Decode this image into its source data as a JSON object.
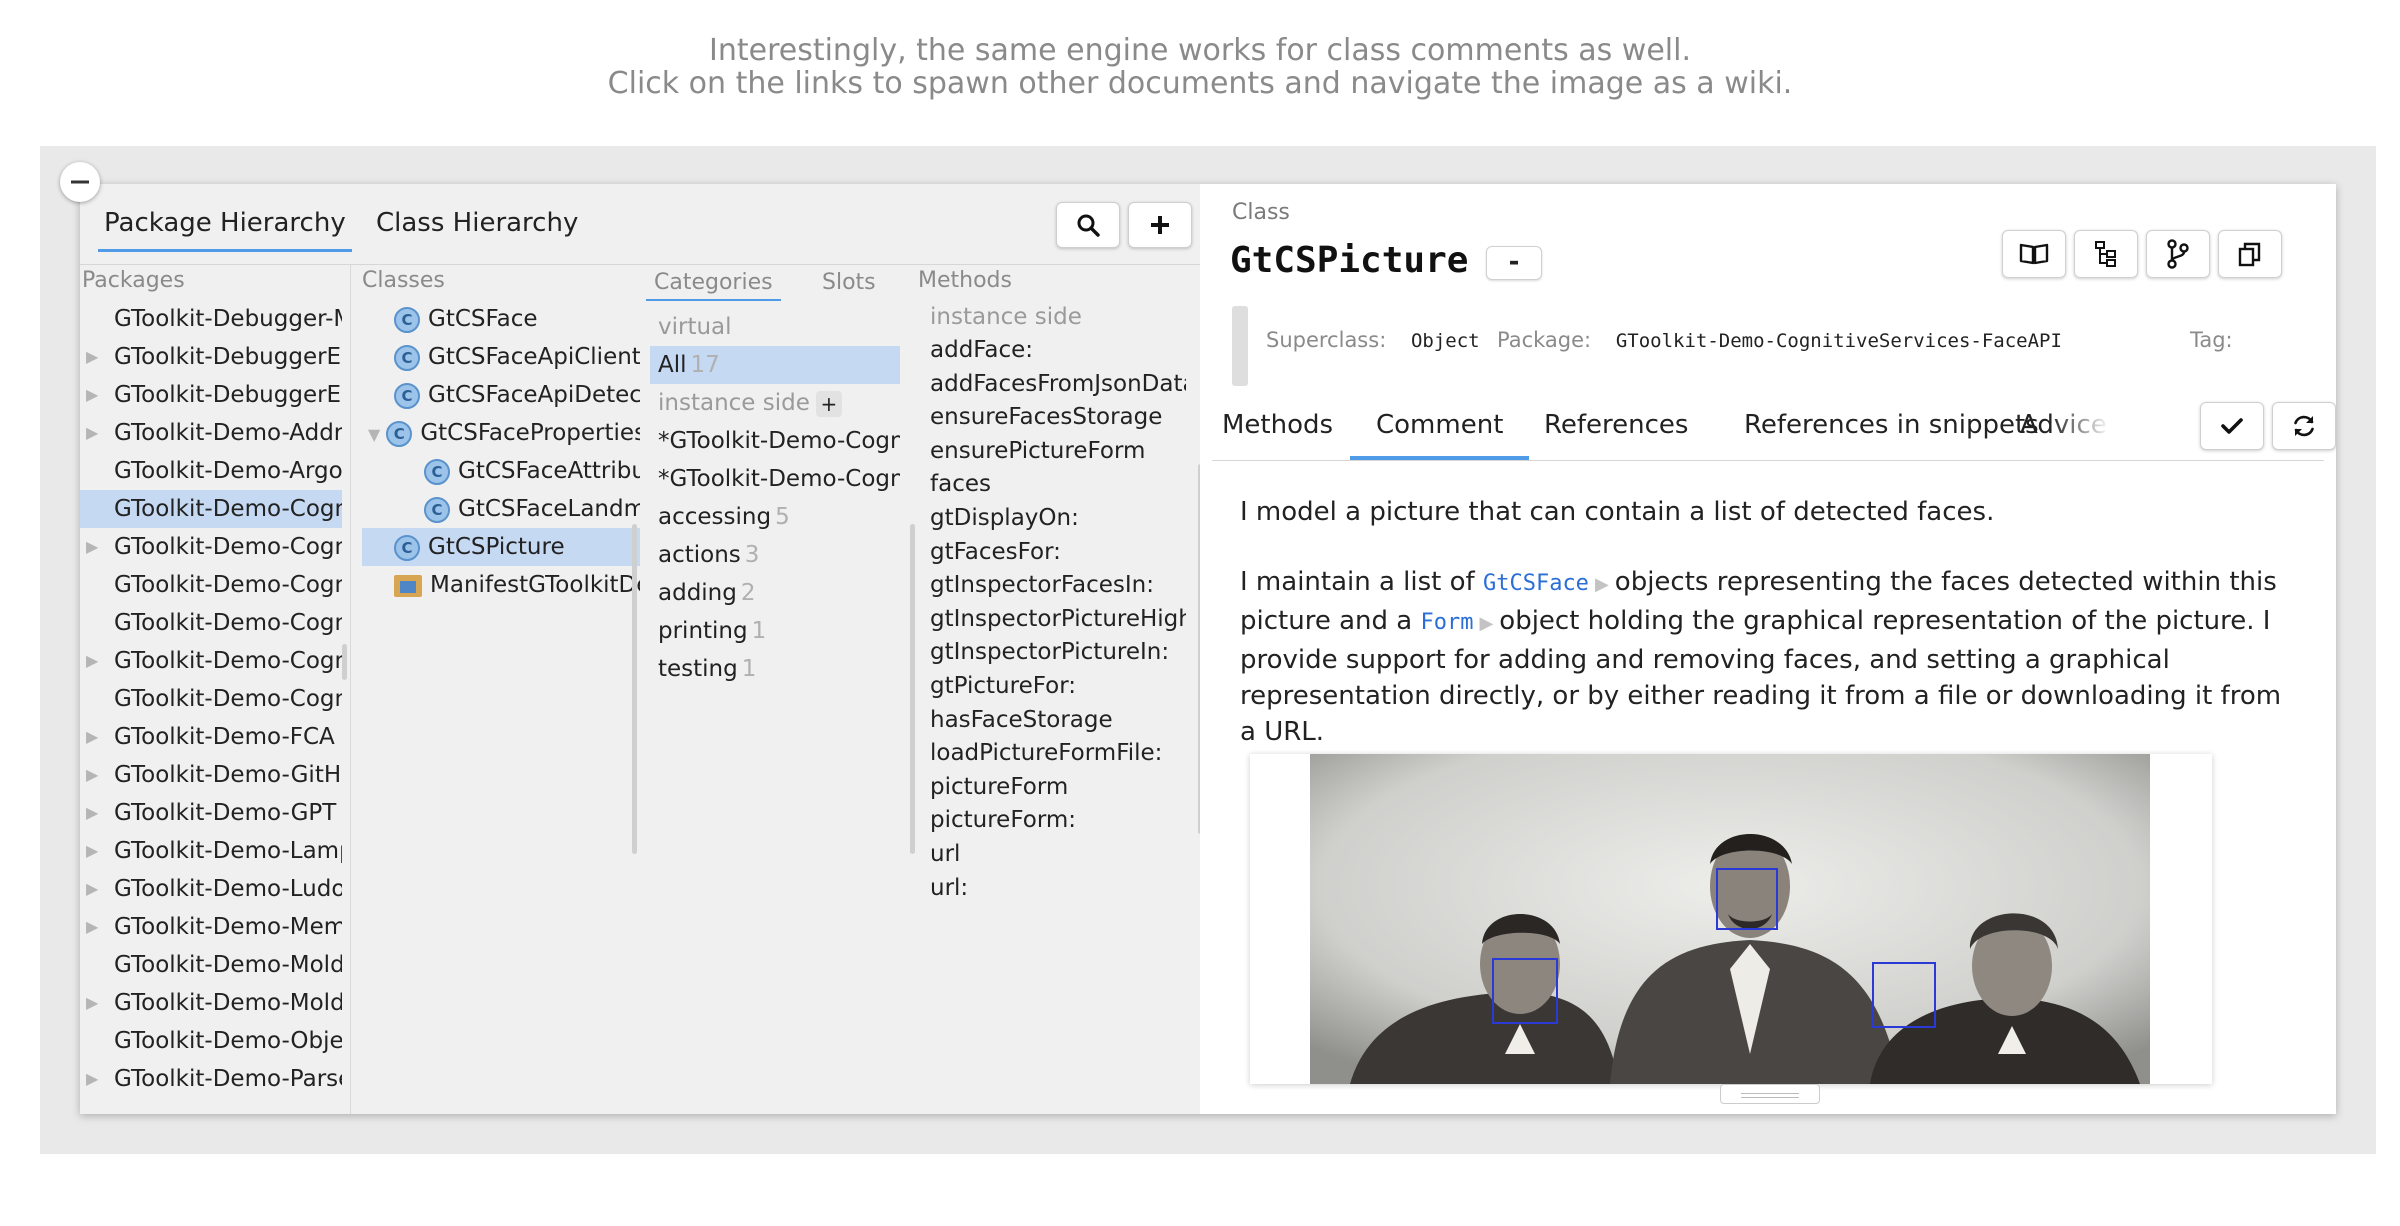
{
  "caption": {
    "line1": "Interestingly, the same engine works for class comments as well.",
    "line2": "Click on the links to spawn other documents and navigate the image as a wiki."
  },
  "header_tabs": {
    "package_hierarchy": "Package Hierarchy",
    "class_hierarchy": "Class Hierarchy"
  },
  "icons": {
    "collapse": "minus-circle-icon",
    "search": "search-icon",
    "add": "plus-icon",
    "book": "book-icon",
    "hierarchy": "hierarchy-icon",
    "git": "git-branch-icon",
    "copy": "copy-icon",
    "accept": "check-icon",
    "refresh": "refresh-icon"
  },
  "packages": {
    "title": "Packages",
    "items": [
      {
        "label": "GToolkit-Debugger-Mo",
        "expandable": false,
        "selected": false
      },
      {
        "label": "GToolkit-DebuggerExte",
        "expandable": true,
        "selected": false
      },
      {
        "label": "GToolkit-DebuggerExte",
        "expandable": true,
        "selected": false
      },
      {
        "label": "GToolkit-Demo-Addres",
        "expandable": true,
        "selected": false
      },
      {
        "label": "GToolkit-Demo-Argour",
        "expandable": false,
        "selected": false
      },
      {
        "label": "GToolkit-Demo-Cognit",
        "expandable": false,
        "selected": true
      },
      {
        "label": "GToolkit-Demo-Cognit",
        "expandable": true,
        "selected": false
      },
      {
        "label": "GToolkit-Demo-Cognit",
        "expandable": false,
        "selected": false
      },
      {
        "label": "GToolkit-Demo-Cognit",
        "expandable": false,
        "selected": false
      },
      {
        "label": "GToolkit-Demo-Cognit",
        "expandable": true,
        "selected": false
      },
      {
        "label": "GToolkit-Demo-Cognit",
        "expandable": false,
        "selected": false
      },
      {
        "label": "GToolkit-Demo-FCA",
        "expandable": true,
        "selected": false
      },
      {
        "label": "GToolkit-Demo-GitHub",
        "expandable": true,
        "selected": false
      },
      {
        "label": "GToolkit-Demo-GPT",
        "expandable": true,
        "selected": false
      },
      {
        "label": "GToolkit-Demo-LampS",
        "expandable": true,
        "selected": false
      },
      {
        "label": "GToolkit-Demo-Ludo",
        "expandable": true,
        "selected": false
      },
      {
        "label": "GToolkit-Demo-Memor",
        "expandable": true,
        "selected": false
      },
      {
        "label": "GToolkit-Demo-Moldal",
        "expandable": false,
        "selected": false
      },
      {
        "label": "GToolkit-Demo-Moldal",
        "expandable": true,
        "selected": false
      },
      {
        "label": "GToolkit-Demo-Object",
        "expandable": false,
        "selected": false
      },
      {
        "label": "GToolkit-Demo-ParseN",
        "expandable": true,
        "selected": false
      }
    ]
  },
  "classes": {
    "title": "Classes",
    "items": [
      {
        "label": "GtCSFace",
        "indent": 0,
        "kind": "class",
        "expand": "",
        "selected": false
      },
      {
        "label": "GtCSFaceApiClient",
        "indent": 0,
        "kind": "class",
        "expand": "",
        "selected": false
      },
      {
        "label": "GtCSFaceApiDetectRe",
        "indent": 0,
        "kind": "class",
        "expand": "",
        "selected": false
      },
      {
        "label": "GtCSFaceProperties",
        "indent": 0,
        "kind": "class",
        "expand": "▼",
        "selected": false
      },
      {
        "label": "GtCSFaceAttribute",
        "indent": 1,
        "kind": "class",
        "expand": "",
        "selected": false
      },
      {
        "label": "GtCSFaceLandma",
        "indent": 1,
        "kind": "class",
        "expand": "",
        "selected": false
      },
      {
        "label": "GtCSPicture",
        "indent": 0,
        "kind": "class",
        "expand": "",
        "selected": true
      },
      {
        "label": "ManifestGToolkitDer",
        "indent": 0,
        "kind": "manifest",
        "expand": "",
        "selected": false
      }
    ]
  },
  "categories": {
    "tab_categories": "Categories",
    "tab_slots": "Slots",
    "virtual_label": "virtual",
    "all_label": "All",
    "all_count": "17",
    "instance_side": "instance side",
    "extensions": [
      "*GToolkit-Demo-Cognitiv",
      "*GToolkit-Demo-Cognitiv"
    ],
    "protocols": [
      {
        "name": "accessing",
        "count": "5"
      },
      {
        "name": "actions",
        "count": "3"
      },
      {
        "name": "adding",
        "count": "2"
      },
      {
        "name": "printing",
        "count": "1"
      },
      {
        "name": "testing",
        "count": "1"
      }
    ]
  },
  "methods": {
    "title": "Methods",
    "side_label": "instance side",
    "items": [
      "addFace:",
      "addFacesFromJsonData:",
      "ensureFacesStorage",
      "ensurePictureForm",
      "faces",
      "gtDisplayOn:",
      "gtFacesFor:",
      "gtInspectorFacesIn:",
      "gtInspectorPictureHighli",
      "gtInspectorPictureIn:",
      "gtPictureFor:",
      "hasFaceStorage",
      "loadPictureFormFile:",
      "pictureForm",
      "pictureForm:",
      "url",
      "url:"
    ]
  },
  "class_view": {
    "label": "Class",
    "title": "GtCSPicture",
    "minus_label": "-",
    "superclass_key": "Superclass:",
    "superclass_val": "Object",
    "package_key": "Package:",
    "package_val": "GToolkit-Demo-CognitiveServices-FaceAPI",
    "tag_key": "Tag:",
    "tabs": [
      "Methods",
      "Comment",
      "References",
      "References in snippets",
      "Advice de"
    ],
    "active_tab": "Comment"
  },
  "comment": {
    "p1": "I model a picture that can contain a list of detected faces.",
    "p2_a": "I maintain a list of",
    "link_face": "GtCSFace",
    "p2_b": "objects representing the faces detected within this picture",
    "p2_c": "and a",
    "link_form": "Form",
    "p2_d": "object holding the graphical representation of the picture. I provide support for adding and removing faces, and setting a graphical representation directly, or by either reading it from a file or downloading it from a URL.",
    "arrow": "▶"
  },
  "colors": {
    "accent": "#4f9be8",
    "selection": "#c6d9f3",
    "link": "#2a6ed6",
    "face_box": "#2b3ad6"
  }
}
